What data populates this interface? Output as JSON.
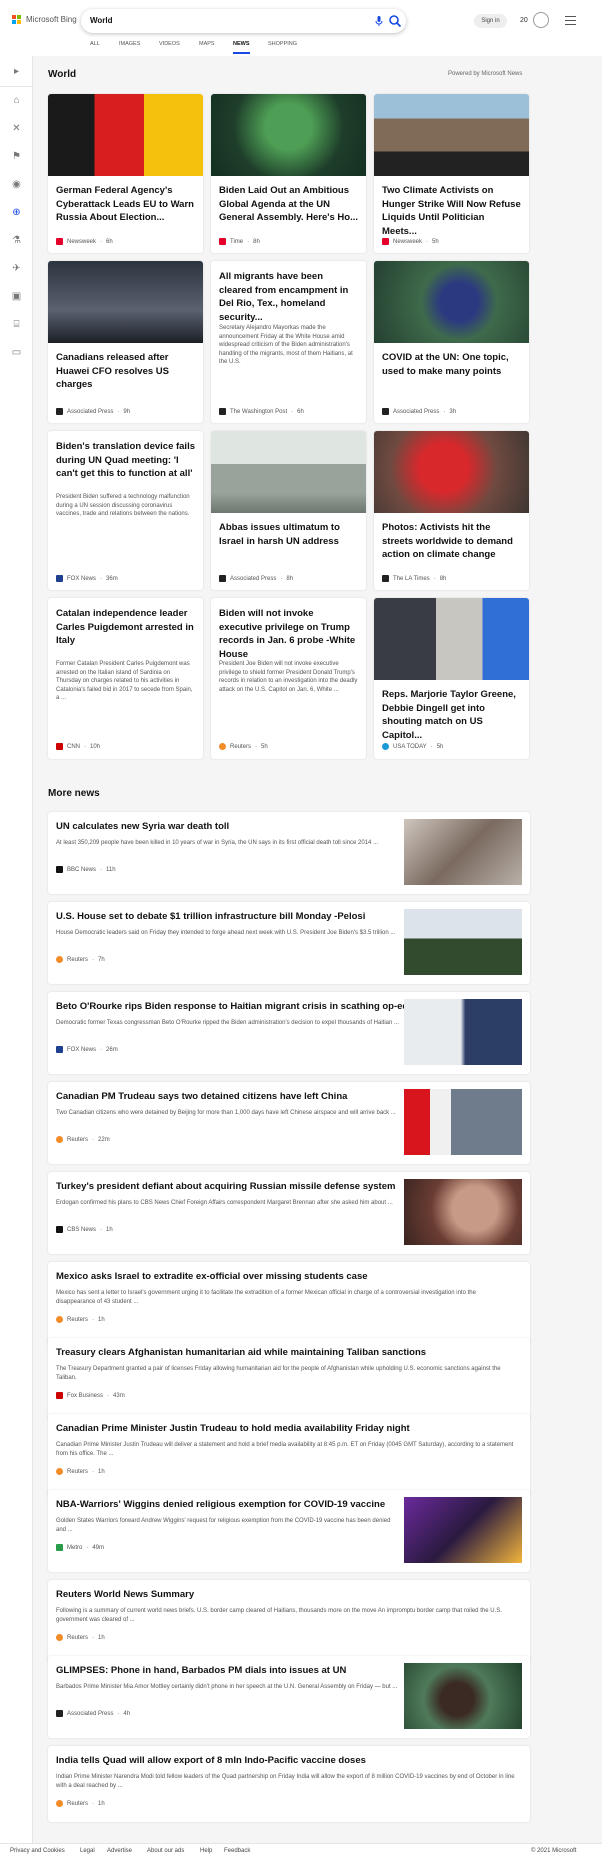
{
  "header": {
    "brand": "Microsoft Bing",
    "query": "World",
    "signin": "Sign in",
    "rewards_count": "20",
    "tabs": [
      "ALL",
      "IMAGES",
      "VIDEOS",
      "MAPS",
      "NEWS",
      "SHOPPING"
    ],
    "active_tab": "NEWS"
  },
  "section": {
    "title": "World",
    "powered": "Powered by Microsoft News"
  },
  "cards": [
    {
      "title": "German Federal Agency's Cyberattack Leads EU to Warn Russia About Election...",
      "snippet": "",
      "source": "Newsweek",
      "time": "6h",
      "logo_color": "#e4002b"
    },
    {
      "title": "Biden Laid Out an Ambitious Global Agenda at the UN General Assembly. Here's Ho...",
      "snippet": "",
      "source": "Time",
      "time": "8h",
      "logo_color": "#e4002b"
    },
    {
      "title": "Two Climate Activists on Hunger Strike Will Now Refuse Liquids Until Politician Meets...",
      "snippet": "",
      "source": "Newsweek",
      "time": "5h",
      "logo_color": "#e4002b"
    },
    {
      "title": "Canadians released after Huawei CFO resolves US charges",
      "snippet": "",
      "source": "Associated Press",
      "time": "9h",
      "logo_color": "#222"
    },
    {
      "title": "All migrants have been cleared from encampment in Del Rio, Tex., homeland security...",
      "snippet": "Secretary Alejandro Mayorkas made the announcement Friday at the White House amid widespread criticism of the Biden administration's handling of the migrants, most of them Haitians, at the U.S.",
      "source": "The Washington Post",
      "time": "6h",
      "logo_color": "#222"
    },
    {
      "title": "COVID at the UN: One topic, used to make many points",
      "snippet": "",
      "source": "Associated Press",
      "time": "3h",
      "logo_color": "#222"
    },
    {
      "title": "Biden's translation device fails during UN Quad meeting: 'I can't get this to function at all'",
      "snippet": "President Biden suffered a technology malfunction during a UN session discussing coronavirus vaccines, trade and relations between the nations.",
      "source": "FOX News",
      "time": "36m",
      "logo_color": "#1f3f8f"
    },
    {
      "title": "Abbas issues ultimatum to Israel in harsh UN address",
      "snippet": "",
      "source": "Associated Press",
      "time": "8h",
      "logo_color": "#222"
    },
    {
      "title": "Photos: Activists hit the streets worldwide to demand action on climate change",
      "snippet": "",
      "source": "The LA Times",
      "time": "8h",
      "logo_color": "#222"
    },
    {
      "title": "Catalan independence leader Carles Puigdemont arrested in Italy",
      "snippet": "Former Catalan President Carles Puigdemont was arrested on the Italian island of Sardinia on Thursday on charges related to his activities in Catalonia's failed bid in 2017 to secede from Spain, a ...",
      "source": "CNN",
      "time": "10h",
      "logo_color": "#cc0000"
    },
    {
      "title": "Biden will not invoke executive privilege on Trump records in Jan. 6 probe -White House",
      "snippet": "President Joe Biden will not invoke executive privilege to shield former President Donald Trump's records in relation to an investigation into the deadly attack on the U.S. Capitol on Jan. 6, White ...",
      "source": "Reuters",
      "time": "5h",
      "logo_color": "#f28c28"
    },
    {
      "title": "Reps. Marjorie Taylor Greene, Debbie Dingell get into shouting match on US Capitol...",
      "snippet": "",
      "source": "USA TODAY",
      "time": "5h",
      "logo_color": "#1a9bd7"
    }
  ],
  "more": {
    "title": "More news",
    "items": [
      {
        "title": "UN calculates new Syria war death toll",
        "snippet": "At least 350,209 people have been killed in 10 years of war in Syria, the UN says in its first official death toll since 2014 ...",
        "source": "BBC News",
        "time": "11h",
        "logo_color": "#111"
      },
      {
        "title": "U.S. House set to debate $1 trillion infrastructure bill Monday -Pelosi",
        "snippet": "House Democratic leaders said on Friday they intended to forge ahead next week with U.S. President Joe Biden's $3.5 trillion ...",
        "source": "Reuters",
        "time": "7h",
        "logo_color": "#f28c28"
      },
      {
        "title": "Beto O'Rourke rips Biden response to Haitian migrant crisis in scathing op-ed",
        "snippet": "Democratic former Texas congressman Beto O'Rourke ripped the Biden administration's decision to expel thousands of Haitian ...",
        "source": "FOX News",
        "time": "26m",
        "logo_color": "#1f3f8f"
      },
      {
        "title": "Canadian PM Trudeau says two detained citizens have left China",
        "snippet": "Two Canadian citizens who were detained by Beijing for more than 1,000 days have left Chinese airspace and will arrive back ...",
        "source": "Reuters",
        "time": "22m",
        "logo_color": "#f28c28"
      },
      {
        "title": "Turkey's president defiant about acquiring Russian missile defense system",
        "snippet": "Erdogan confirmed his plans to CBS News Chief Foreign Affairs correspondent Margaret Brennan after she asked him about ...",
        "source": "CBS News",
        "time": "1h",
        "logo_color": "#111"
      },
      {
        "title": "Mexico asks Israel to extradite ex-official over missing students case",
        "snippet": "Mexico has sent a letter to Israel's government urging it to facilitate the extradition of a former Mexican official in charge of a controversial investigation into the disappearance of 43 student ...",
        "source": "Reuters",
        "time": "1h",
        "logo_color": "#f28c28"
      },
      {
        "title": "Treasury clears Afghanistan humanitarian aid while maintaining Taliban sanctions",
        "snippet": "The Treasury Department granted a pair of licenses Friday allowing humanitarian aid for the people of Afghanistan while upholding U.S. economic sanctions against the Taliban.",
        "source": "Fox Business",
        "time": "43m",
        "logo_color": "#cc0000"
      },
      {
        "title": "Canadian Prime Minister Justin Trudeau to hold media availability Friday night",
        "snippet": "Canadian Prime Minister Justin Trudeau will deliver a statement and hold a brief media availability at 8:45 p.m. ET on Friday (0045 GMT Saturday), according to a statement from his office. The ...",
        "source": "Reuters",
        "time": "1h",
        "logo_color": "#f28c28"
      },
      {
        "title": "NBA-Warriors' Wiggins denied religious exemption for COVID-19 vaccine",
        "snippet": "Golden States Warriors forward Andrew Wiggins' request for religious exemption from the COVID-19 vaccine has been denied and ...",
        "source": "Metro",
        "time": "49m",
        "logo_color": "#2a9d4b"
      },
      {
        "title": "Reuters World News Summary",
        "snippet": "Following is a summary of current world news briefs. U.S. border camp cleared of Haitians, thousands more on the move An impromptu border camp that roiled the U.S. government was cleared of ...",
        "source": "Reuters",
        "time": "1h",
        "logo_color": "#f28c28"
      },
      {
        "title": "GLIMPSES: Phone in hand, Barbados PM dials into issues at UN",
        "snippet": "Barbados Prime Minister Mia Amor Mottley certainly didn't phone in her speech at the U.N. General Assembly on Friday — but ...",
        "source": "Associated Press",
        "time": "4h",
        "logo_color": "#222"
      },
      {
        "title": "India tells Quad will allow export of 8 mln Indo-Pacific vaccine doses",
        "snippet": "Indian Prime Minister Narendra Modi told fellow leaders of the Quad partnership on Friday India will allow the export of 8 million COVID-19 vaccines by end of October in line with a deal reached by ...",
        "source": "Reuters",
        "time": "1h",
        "logo_color": "#f28c28"
      }
    ]
  },
  "footer": {
    "links": [
      "Privacy and Cookies",
      "Legal",
      "Advertise",
      "About our ads",
      "Help",
      "Feedback"
    ],
    "copyright": "© 2021 Microsoft"
  },
  "icons": {
    "sidebar": [
      "expand-icon",
      "home-icon",
      "sports-icon",
      "politics-flag-icon",
      "us-location-icon",
      "world-globe-icon",
      "science-icon",
      "technology-rocket-icon",
      "entertainment-icon",
      "business-icon",
      "money-icon"
    ]
  }
}
